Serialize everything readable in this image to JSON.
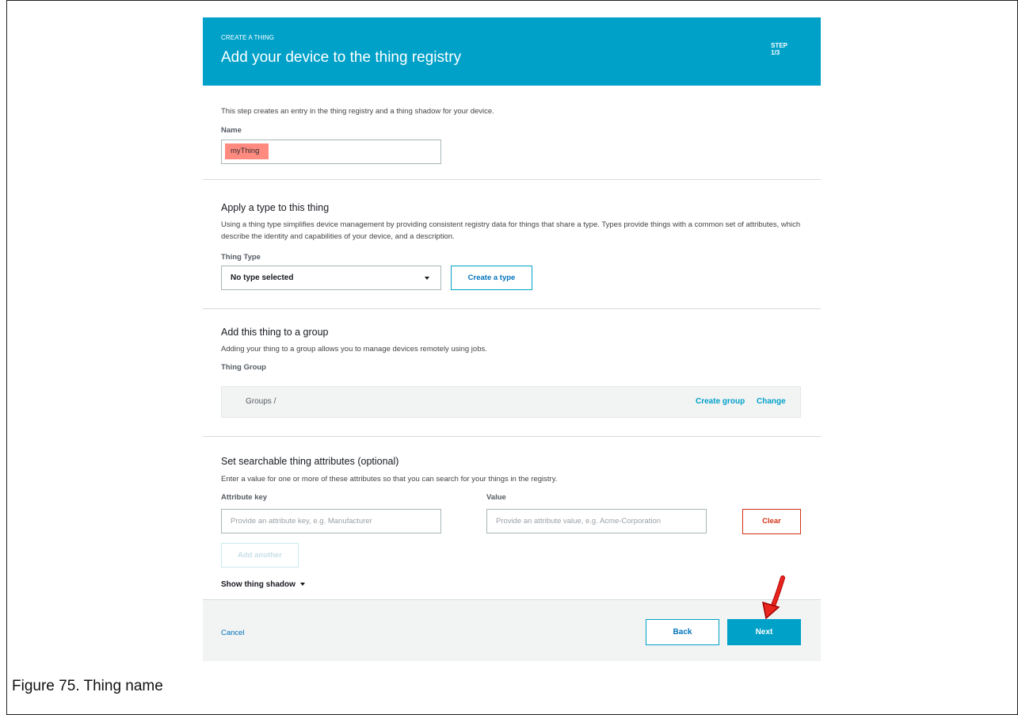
{
  "header": {
    "eyebrow": "CREATE A THING",
    "title": "Add your device to the thing registry",
    "step_label": "STEP",
    "step_value": "1/3",
    "color": "#00a1c9"
  },
  "name_section": {
    "intro": "This step creates an entry in the thing registry and a thing shadow for your device.",
    "label": "Name",
    "value": "myThing",
    "highlight_color": "#ff8a80"
  },
  "type_section": {
    "title": "Apply a type to this thing",
    "description": "Using a thing type simplifies device management by providing consistent registry data for things that share a type. Types provide things with a common set of attributes, which describe the identity and capabilities of your device, and a description.",
    "label": "Thing Type",
    "selected": "No type selected",
    "create_button": "Create a type"
  },
  "group_section": {
    "title": "Add this thing to a group",
    "description": "Adding your thing to a group allows you to manage devices remotely using jobs.",
    "label": "Thing Group",
    "breadcrumb": "Groups /",
    "create_link": "Create group",
    "change_link": "Change"
  },
  "attributes_section": {
    "title": "Set searchable thing attributes (optional)",
    "description": "Enter a value for one or more of these attributes so that you can search for your things in the registry.",
    "key_label": "Attribute key",
    "value_label": "Value",
    "key_placeholder": "Provide an attribute key, e.g. Manufacturer",
    "value_placeholder": "Provide an attribute value, e.g. Acme-Corporation",
    "clear_button": "Clear",
    "add_button": "Add another",
    "shadow_toggle": "Show thing shadow"
  },
  "footer": {
    "cancel": "Cancel",
    "back": "Back",
    "next": "Next"
  },
  "caption": "Figure 75. Thing name",
  "icons": {
    "annotation": "red-arrow-icon",
    "dropdown": "caret-down-icon"
  }
}
